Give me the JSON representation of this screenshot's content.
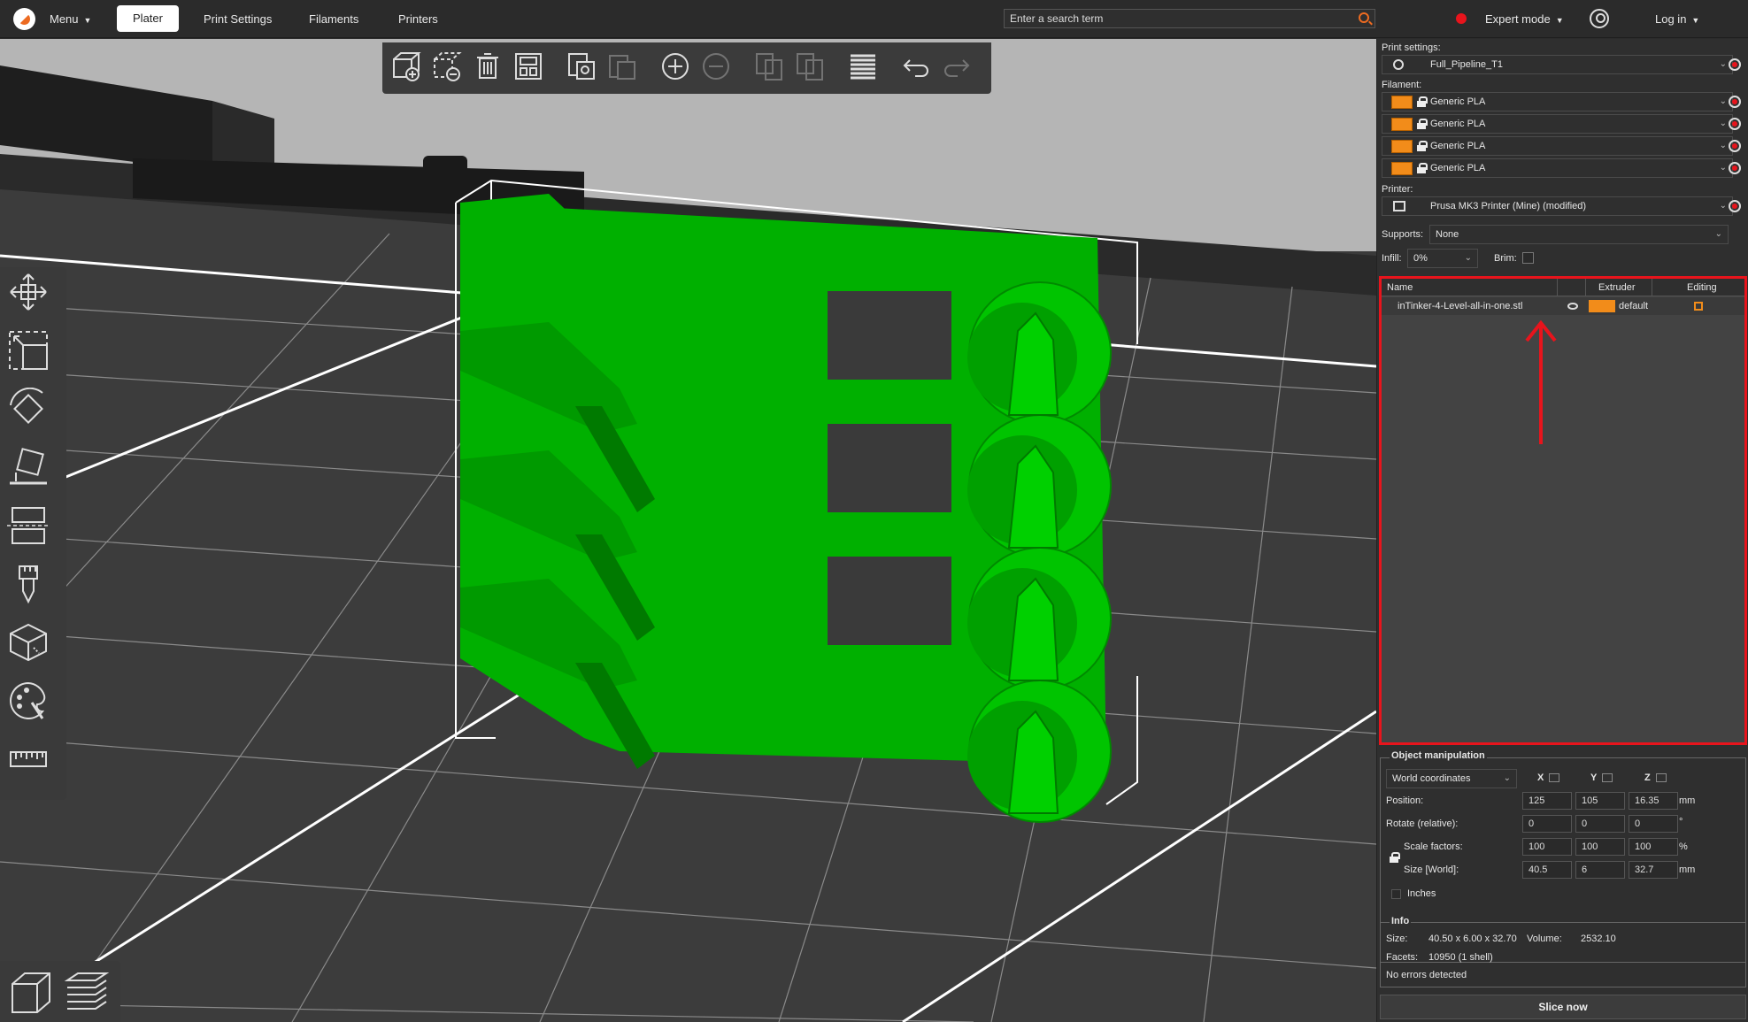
{
  "topbar": {
    "menu_label": "Menu",
    "tabs": [
      {
        "label": "Plater"
      },
      {
        "label": "Print Settings"
      },
      {
        "label": "Filaments"
      },
      {
        "label": "Printers"
      }
    ],
    "search_placeholder": "Enter a search term",
    "mode_label": "Expert mode",
    "mode_color": "#e8141c",
    "login_label": "Log in"
  },
  "viewport": {
    "model_color": "#00b000",
    "top_toolbar_icons": [
      "add-icon",
      "delete-icon",
      "delete-all-icon",
      "arrange-icon",
      "copy-icon",
      "paste-icon",
      "add-instance-icon",
      "remove-instance-icon",
      "split-objects-icon",
      "split-parts-icon",
      "variable-layer-height-icon",
      "undo-icon",
      "redo-icon"
    ],
    "left_toolbar_icons": [
      "move-icon",
      "scale-icon",
      "rotate-icon",
      "place-on-face-icon",
      "cut-icon",
      "support-painting-icon",
      "seam-painting-icon",
      "mmu-painting-icon",
      "measure-icon"
    ],
    "view_buttons": [
      "3d-view-icon",
      "preview-layers-icon"
    ]
  },
  "sidebar": {
    "print_settings_label": "Print settings:",
    "print_profile": "Full_Pipeline_T1",
    "filament_label": "Filament:",
    "filaments": [
      {
        "name": "Generic PLA",
        "color": "#f28c1a"
      },
      {
        "name": "Generic PLA",
        "color": "#f28c1a"
      },
      {
        "name": "Generic PLA",
        "color": "#f28c1a"
      },
      {
        "name": "Generic PLA",
        "color": "#f28c1a"
      }
    ],
    "printer_label": "Printer:",
    "printer_profile": "Prusa MK3 Printer (Mine) (modified)",
    "supports_label": "Supports:",
    "supports_value": "None",
    "infill_label": "Infill:",
    "infill_value": "0%",
    "brim_label": "Brim:",
    "object_list": {
      "columns": [
        "Name",
        "Extruder",
        "Editing"
      ],
      "rows": [
        {
          "name": "inTinker-4-Level-all-in-one.stl",
          "extruder": "default"
        }
      ],
      "highlight_color": "#e8141c"
    },
    "manipulation": {
      "title": "Object manipulation",
      "coord_system": "World coordinates",
      "axes": [
        "X",
        "Y",
        "Z"
      ],
      "rows": [
        {
          "label": "Position:",
          "values": [
            "125",
            "105",
            "16.35"
          ],
          "unit": "mm"
        },
        {
          "label": "Rotate (relative):",
          "values": [
            "0",
            "0",
            "0"
          ],
          "unit": "°"
        },
        {
          "label": "Scale factors:",
          "values": [
            "100",
            "100",
            "100"
          ],
          "unit": "%"
        },
        {
          "label": "Size [World]:",
          "values": [
            "40.5",
            "6",
            "32.7"
          ],
          "unit": "mm"
        }
      ],
      "inches_label": "Inches"
    },
    "info": {
      "title": "Info",
      "size_label": "Size:",
      "size_value": "40.50 x 6.00 x 32.70",
      "volume_label": "Volume:",
      "volume_value": "2532.10",
      "facets_label": "Facets:",
      "facets_value": "10950 (1 shell)",
      "errors": "No errors detected"
    },
    "slice_label": "Slice now"
  }
}
